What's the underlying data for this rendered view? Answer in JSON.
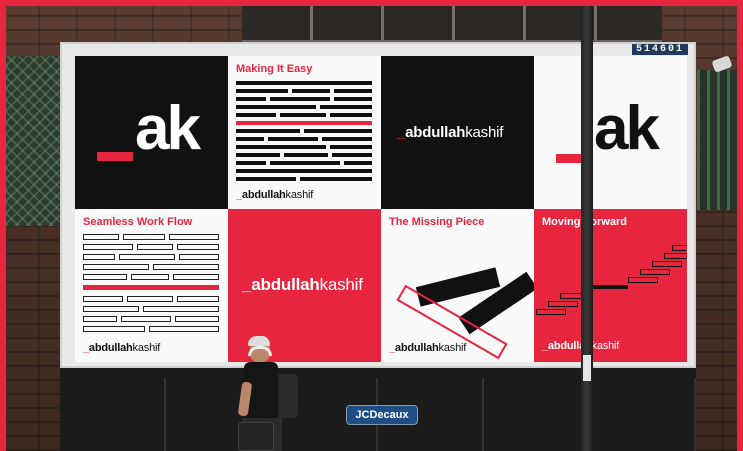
{
  "billboard": {
    "id_number": "514601",
    "sponsor_badge": "JCDecaux"
  },
  "brand": {
    "monogram": "ak",
    "logo_bold": "abdullah",
    "logo_light": "kashif",
    "colors": {
      "red": "#e8253f",
      "black": "#111111",
      "white": "#fafafa"
    }
  },
  "tiles": {
    "making_it_easy": "Making It Easy",
    "seamless_work_flow": "Seamless Work Flow",
    "the_missing_piece": "The Missing Piece",
    "moving_forward": "Moving Forward"
  }
}
